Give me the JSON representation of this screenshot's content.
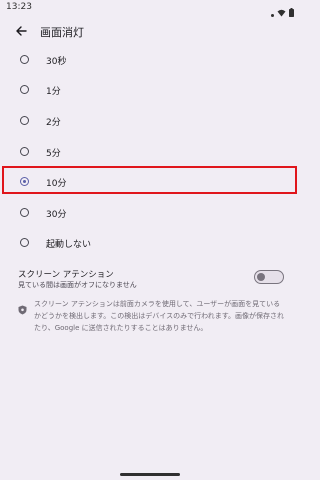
{
  "status": {
    "time": "13:23"
  },
  "app_bar": {
    "title": "画面消灯"
  },
  "options": [
    {
      "label": "30秒",
      "checked": false
    },
    {
      "label": "1分",
      "checked": false
    },
    {
      "label": "2分",
      "checked": false
    },
    {
      "label": "5分",
      "checked": false
    },
    {
      "label": "10分",
      "checked": true
    },
    {
      "label": "30分",
      "checked": false
    },
    {
      "label": "起動しない",
      "checked": false
    }
  ],
  "screen_attention": {
    "title": "スクリーン アテンション",
    "subtitle": "見ている間は画面がオフになりません",
    "enabled": false
  },
  "info": {
    "text": "スクリーン アテンションは前面カメラを使用して、ユーザーが画面を見ているかどうかを検出します。この検出はデバイスのみで行われます。画像が保存されたり、Google に送信されたりすることはありません。"
  },
  "colors": {
    "accent": "#5b5fa8",
    "highlight": "#e0151b",
    "background": "#f1edf4"
  }
}
